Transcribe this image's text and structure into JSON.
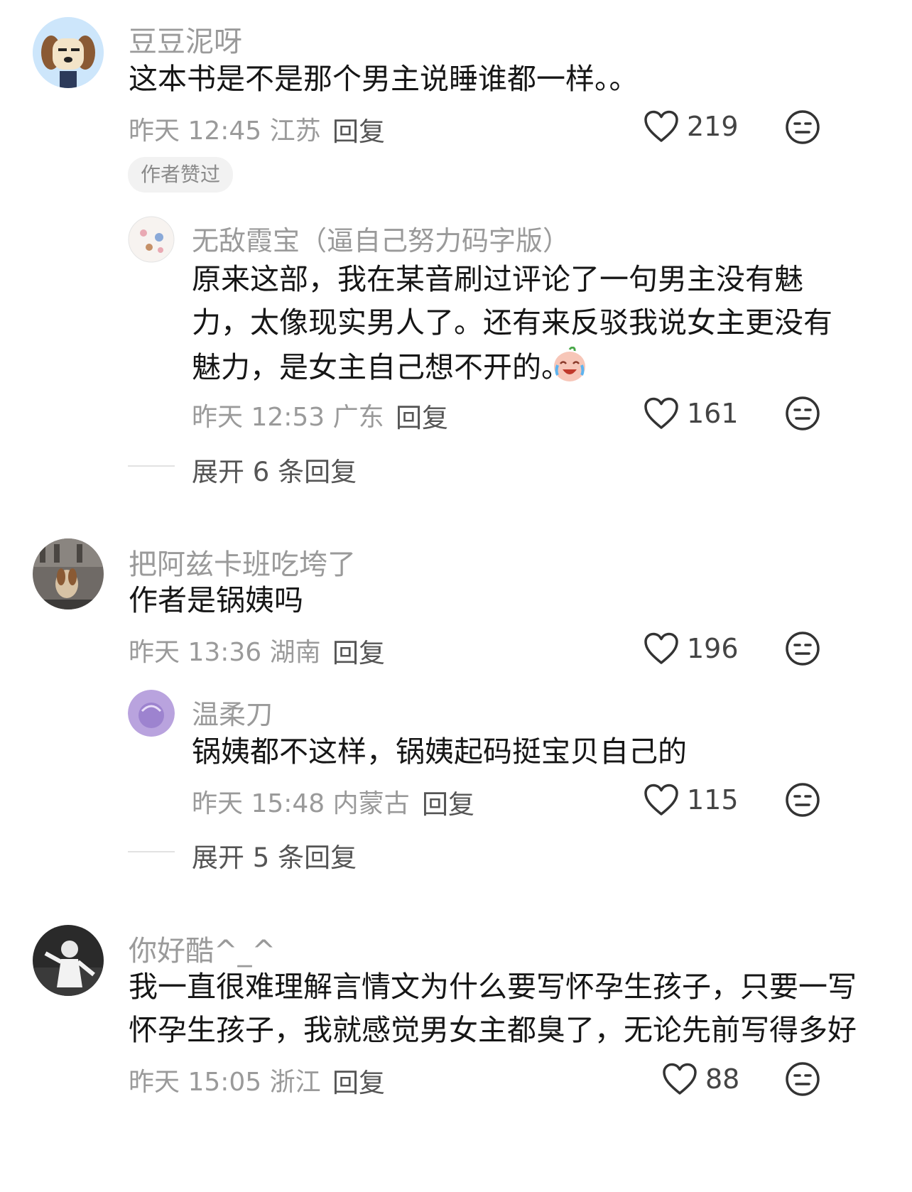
{
  "comments": [
    {
      "username": "豆豆泥呀",
      "text_lines": [
        "这本书是不是那个男主说睡谁都一样。。"
      ],
      "time": "昨天 12:45",
      "location": "江苏",
      "reply_label": "回复",
      "likes": "219",
      "badge": "作者赞过",
      "avatar_icon": "cartoon-dog-avatar"
    },
    {
      "username": "无敌霞宝（逼自己努力码字版）",
      "text_lines": [
        "原来这部，我在某音刷过评论了一句男主没有魅",
        "力，太像现实男人了。还有来反驳我说女主更没有",
        "魅力，是女主自己想不开的。"
      ],
      "emoji_icon": "laugh-cry-emoji",
      "time": "昨天 12:53",
      "location": "广东",
      "reply_label": "回复",
      "likes": "161",
      "avatar_icon": "flowers-avatar"
    },
    {
      "expand": "展开 6 条回复"
    },
    {
      "username": "把阿兹卡班吃垮了",
      "text_lines": [
        "作者是锅姨吗"
      ],
      "time": "昨天 13:36",
      "location": "湖南",
      "reply_label": "回复",
      "likes": "196",
      "avatar_icon": "dog-photo-avatar"
    },
    {
      "username": "温柔刀",
      "text_lines": [
        "锅姨都不这样，锅姨起码挺宝贝自己的"
      ],
      "time": "昨天 15:48",
      "location": "内蒙古",
      "reply_label": "回复",
      "likes": "115",
      "avatar_icon": "purple-avatar"
    },
    {
      "expand": "展开 5 条回复"
    },
    {
      "username": "你好酷^_^",
      "text_lines": [
        "我一直很难理解言情文为什么要写怀孕生孩子，只要一写",
        "怀孕生孩子，我就感觉男女主都臭了，无论先前写得多好"
      ],
      "time": "昨天 15:05",
      "location": "浙江",
      "reply_label": "回复",
      "likes": "88",
      "avatar_icon": "performer-photo-avatar"
    }
  ],
  "icons": {
    "like": "heart-icon",
    "reaction": "neutral-face-icon"
  },
  "colors": {
    "secondary_text": "#9a9a9a",
    "primary_text": "#161616",
    "badge_bg": "#f2f2f2"
  }
}
